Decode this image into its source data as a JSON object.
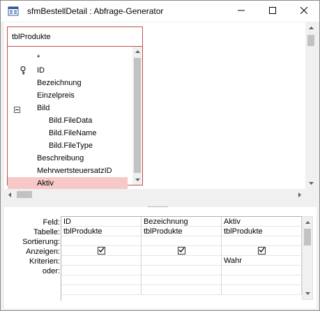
{
  "window": {
    "title": "sfmBestellDetail : Abfrage-Generator"
  },
  "table": {
    "name": "tblProdukte",
    "fields": [
      {
        "label": "*",
        "indent": 0,
        "key": false,
        "expand": false,
        "selected": false
      },
      {
        "label": "ID",
        "indent": 0,
        "key": true,
        "expand": false,
        "selected": false
      },
      {
        "label": "Bezeichnung",
        "indent": 0,
        "key": false,
        "expand": false,
        "selected": false
      },
      {
        "label": "Einzelpreis",
        "indent": 0,
        "key": false,
        "expand": false,
        "selected": false
      },
      {
        "label": "Bild",
        "indent": 0,
        "key": false,
        "expand": true,
        "selected": false
      },
      {
        "label": "Bild.FileData",
        "indent": 1,
        "key": false,
        "expand": false,
        "selected": false
      },
      {
        "label": "Bild.FileName",
        "indent": 1,
        "key": false,
        "expand": false,
        "selected": false
      },
      {
        "label": "Bild.FileType",
        "indent": 1,
        "key": false,
        "expand": false,
        "selected": false
      },
      {
        "label": "Beschreibung",
        "indent": 0,
        "key": false,
        "expand": false,
        "selected": false
      },
      {
        "label": "MehrwertsteuersatzID",
        "indent": 0,
        "key": false,
        "expand": false,
        "selected": false
      },
      {
        "label": "Aktiv",
        "indent": 0,
        "key": false,
        "expand": false,
        "selected": true
      }
    ]
  },
  "grid": {
    "row_labels": [
      "Feld:",
      "Tabelle:",
      "Sortierung:",
      "Anzeigen:",
      "Kriterien:",
      "oder:"
    ],
    "columns": [
      {
        "field": "ID",
        "table": "tblProdukte",
        "sort": "",
        "show": true,
        "criteria": "",
        "or": ""
      },
      {
        "field": "Bezeichnung",
        "table": "tblProdukte",
        "sort": "",
        "show": true,
        "criteria": "",
        "or": ""
      },
      {
        "field": "Aktiv",
        "table": "tblProdukte",
        "sort": "",
        "show": true,
        "criteria": "Wahr",
        "or": ""
      }
    ]
  },
  "icons": {
    "app": "query-designer-icon",
    "minimize": "minimize-icon",
    "maximize": "maximize-icon",
    "close": "close-icon",
    "key": "primary-key-icon",
    "collapse": "collapse-icon"
  }
}
